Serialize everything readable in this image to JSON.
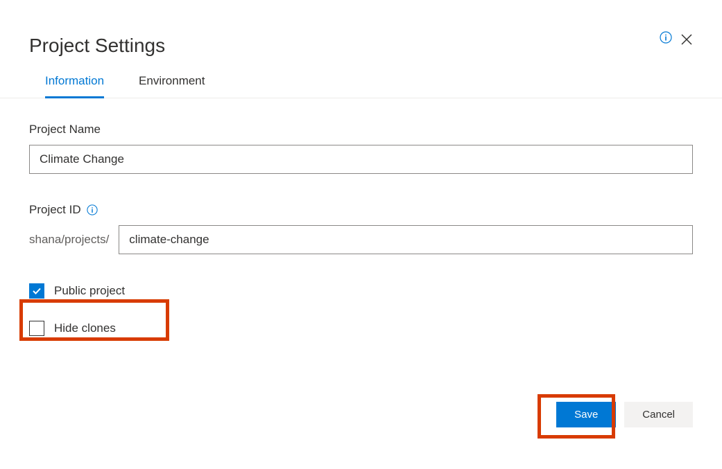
{
  "dialog": {
    "title": "Project Settings"
  },
  "tabs": {
    "information": "Information",
    "environment": "Environment"
  },
  "fields": {
    "projectName": {
      "label": "Project Name",
      "value": "Climate Change"
    },
    "projectId": {
      "label": "Project ID",
      "prefix": "shana/projects/",
      "value": "climate-change"
    },
    "publicProject": {
      "label": "Public project",
      "checked": true
    },
    "hideClones": {
      "label": "Hide clones",
      "checked": false
    }
  },
  "buttons": {
    "save": "Save",
    "cancel": "Cancel"
  }
}
